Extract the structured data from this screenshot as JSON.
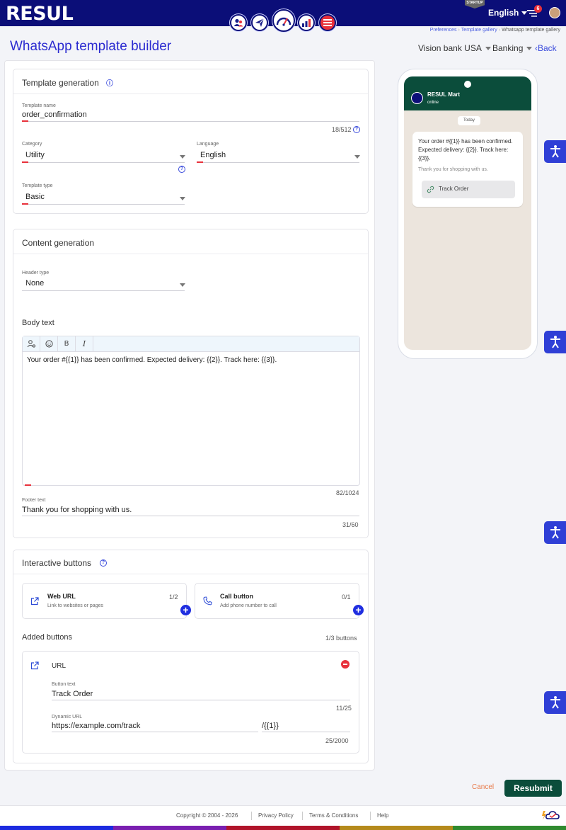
{
  "app": {
    "logo": "RESUL",
    "startup_badge": "STARTUP",
    "language": "English",
    "notification_count": "6"
  },
  "breadcrumb": [
    "Preferences",
    "Template gallery",
    "Whatsapp template gallery"
  ],
  "page": {
    "title": "WhatsApp template builder",
    "account": "Vision bank USA",
    "industry": "Banking",
    "back": "Back"
  },
  "template_generation": {
    "title": "Template generation",
    "name_label": "Template name",
    "name_value": "order_confirmation",
    "name_counter": "18/512",
    "category_label": "Category",
    "category_value": "Utility",
    "language_label": "Language",
    "language_value": "English",
    "type_label": "Template type",
    "type_value": "Basic"
  },
  "content_generation": {
    "title": "Content generation",
    "header_label": "Header type",
    "header_value": "None",
    "body_label": "Body text",
    "body_value": "Your order #{{1}} has been confirmed. Expected delivery: {{2}}. Track here: {{3}}.",
    "body_counter": "82/1024",
    "footer_label": "Footer text",
    "footer_value": "Thank you for shopping with us.",
    "footer_counter": "31/60"
  },
  "interactive": {
    "title": "Interactive buttons",
    "web": {
      "title": "Web URL",
      "desc": "Link to websites or pages",
      "count": "1/2"
    },
    "call": {
      "title": "Call button",
      "desc": "Add phone number to call",
      "count": "0/1"
    },
    "added_title": "Added buttons",
    "added_count": "1/3 buttons",
    "url_block": {
      "type": "URL",
      "text_label": "Button text",
      "text_value": "Track Order",
      "text_counter": "11/25",
      "url_label": "Dynamic URL",
      "url_value": "https://example.com/track",
      "url_suffix": "/{{1}}",
      "url_counter": "25/2000"
    }
  },
  "preview": {
    "contact": "RESUL Mart",
    "status": "online",
    "date_chip": "Today",
    "body": "Your order #{{1}} has been confirmed. Expected delivery: {{2}}. Track here: {{3}}.",
    "footer": "Thank you for shopping with us.",
    "button": "Track Order"
  },
  "actions": {
    "cancel": "Cancel",
    "resubmit": "Resubmit"
  },
  "footer": {
    "copyright": "Copyright © 2004 - 2026",
    "links": [
      "Privacy Policy",
      "Terms & Conditions",
      "Help"
    ]
  },
  "colors": {
    "brand": "#0b0e78",
    "accent": "#2b2bd0",
    "whatsapp": "#0b4d3b",
    "danger": "#e8313b"
  }
}
